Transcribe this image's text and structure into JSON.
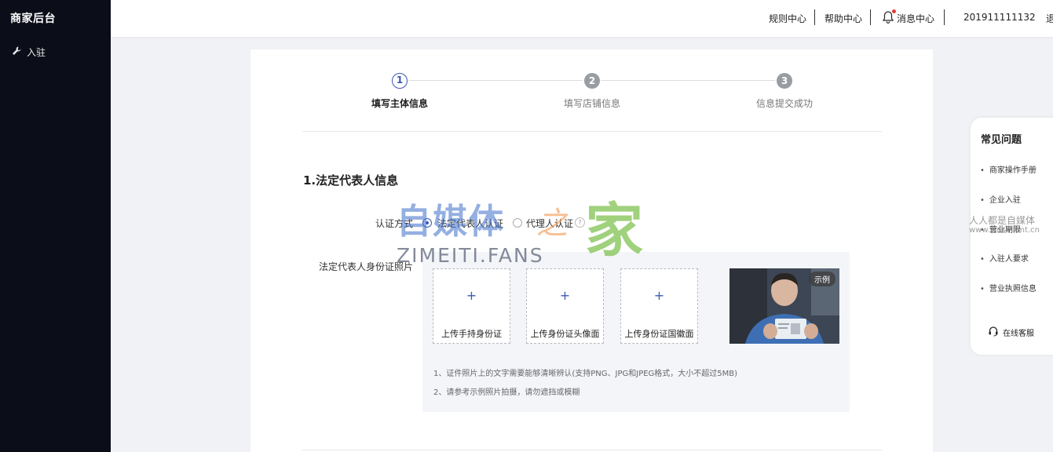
{
  "sidebar": {
    "brand": "商家后台",
    "items": [
      {
        "label": "入驻",
        "icon": "wrench-icon"
      }
    ]
  },
  "topbar": {
    "links": [
      "规则中心",
      "帮助中心",
      "消息中心"
    ],
    "account": "201911111132",
    "logout": "退"
  },
  "steps": [
    {
      "num": "1",
      "label": "填写主体信息",
      "state": "active"
    },
    {
      "num": "2",
      "label": "填写店铺信息",
      "state": "todo"
    },
    {
      "num": "3",
      "label": "信息提交成功",
      "state": "todo"
    }
  ],
  "section": {
    "title": "1.法定代表人信息",
    "auth_label": "认证方式",
    "auth_options": [
      "法定代表人认证",
      "代理人认证"
    ],
    "auth_selected": "法定代表人认证",
    "photo_label": "法定代表人身份证照片",
    "uploads": [
      "上传手持身份证",
      "上传身份证头像面",
      "上传身份证国徽面"
    ],
    "plus": "+",
    "sample_badge": "示例",
    "notes": [
      "1、证件照片上的文字需要能够清晰辨认(支持PNG、JPG和JPEG格式，大小不超过5MB)",
      "2、请参考示例照片拍摄，请勿遮挡或模糊"
    ]
  },
  "faq": {
    "title": "常见问题",
    "items": [
      "商家操作手册",
      "企业入驻",
      "营业期限",
      "入驻人要求",
      "营业执照信息"
    ],
    "service": "在线客服"
  },
  "watermark": {
    "logo_cn": "自媒体",
    "logo_zhi": "之",
    "logo_jia": "家",
    "logo_en": "ZIMEITI.FANS",
    "side_cn": "人人都是自媒体",
    "side_url": "www.wosmzmt.cn"
  },
  "colors": {
    "accent": "#3a58b6",
    "sidebar_bg": "#0b0d18",
    "page_bg": "#f1f2f5"
  }
}
